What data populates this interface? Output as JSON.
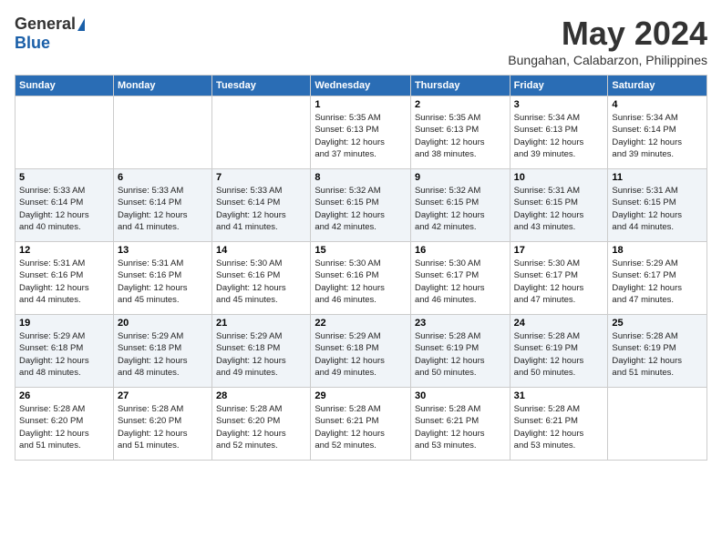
{
  "header": {
    "logo_general": "General",
    "logo_blue": "Blue",
    "month_year": "May 2024",
    "location": "Bungahan, Calabarzon, Philippines"
  },
  "days_of_week": [
    "Sunday",
    "Monday",
    "Tuesday",
    "Wednesday",
    "Thursday",
    "Friday",
    "Saturday"
  ],
  "weeks": [
    [
      {
        "day": "",
        "info": ""
      },
      {
        "day": "",
        "info": ""
      },
      {
        "day": "",
        "info": ""
      },
      {
        "day": "1",
        "info": "Sunrise: 5:35 AM\nSunset: 6:13 PM\nDaylight: 12 hours\nand 37 minutes."
      },
      {
        "day": "2",
        "info": "Sunrise: 5:35 AM\nSunset: 6:13 PM\nDaylight: 12 hours\nand 38 minutes."
      },
      {
        "day": "3",
        "info": "Sunrise: 5:34 AM\nSunset: 6:13 PM\nDaylight: 12 hours\nand 39 minutes."
      },
      {
        "day": "4",
        "info": "Sunrise: 5:34 AM\nSunset: 6:14 PM\nDaylight: 12 hours\nand 39 minutes."
      }
    ],
    [
      {
        "day": "5",
        "info": "Sunrise: 5:33 AM\nSunset: 6:14 PM\nDaylight: 12 hours\nand 40 minutes."
      },
      {
        "day": "6",
        "info": "Sunrise: 5:33 AM\nSunset: 6:14 PM\nDaylight: 12 hours\nand 41 minutes."
      },
      {
        "day": "7",
        "info": "Sunrise: 5:33 AM\nSunset: 6:14 PM\nDaylight: 12 hours\nand 41 minutes."
      },
      {
        "day": "8",
        "info": "Sunrise: 5:32 AM\nSunset: 6:15 PM\nDaylight: 12 hours\nand 42 minutes."
      },
      {
        "day": "9",
        "info": "Sunrise: 5:32 AM\nSunset: 6:15 PM\nDaylight: 12 hours\nand 42 minutes."
      },
      {
        "day": "10",
        "info": "Sunrise: 5:31 AM\nSunset: 6:15 PM\nDaylight: 12 hours\nand 43 minutes."
      },
      {
        "day": "11",
        "info": "Sunrise: 5:31 AM\nSunset: 6:15 PM\nDaylight: 12 hours\nand 44 minutes."
      }
    ],
    [
      {
        "day": "12",
        "info": "Sunrise: 5:31 AM\nSunset: 6:16 PM\nDaylight: 12 hours\nand 44 minutes."
      },
      {
        "day": "13",
        "info": "Sunrise: 5:31 AM\nSunset: 6:16 PM\nDaylight: 12 hours\nand 45 minutes."
      },
      {
        "day": "14",
        "info": "Sunrise: 5:30 AM\nSunset: 6:16 PM\nDaylight: 12 hours\nand 45 minutes."
      },
      {
        "day": "15",
        "info": "Sunrise: 5:30 AM\nSunset: 6:16 PM\nDaylight: 12 hours\nand 46 minutes."
      },
      {
        "day": "16",
        "info": "Sunrise: 5:30 AM\nSunset: 6:17 PM\nDaylight: 12 hours\nand 46 minutes."
      },
      {
        "day": "17",
        "info": "Sunrise: 5:30 AM\nSunset: 6:17 PM\nDaylight: 12 hours\nand 47 minutes."
      },
      {
        "day": "18",
        "info": "Sunrise: 5:29 AM\nSunset: 6:17 PM\nDaylight: 12 hours\nand 47 minutes."
      }
    ],
    [
      {
        "day": "19",
        "info": "Sunrise: 5:29 AM\nSunset: 6:18 PM\nDaylight: 12 hours\nand 48 minutes."
      },
      {
        "day": "20",
        "info": "Sunrise: 5:29 AM\nSunset: 6:18 PM\nDaylight: 12 hours\nand 48 minutes."
      },
      {
        "day": "21",
        "info": "Sunrise: 5:29 AM\nSunset: 6:18 PM\nDaylight: 12 hours\nand 49 minutes."
      },
      {
        "day": "22",
        "info": "Sunrise: 5:29 AM\nSunset: 6:18 PM\nDaylight: 12 hours\nand 49 minutes."
      },
      {
        "day": "23",
        "info": "Sunrise: 5:28 AM\nSunset: 6:19 PM\nDaylight: 12 hours\nand 50 minutes."
      },
      {
        "day": "24",
        "info": "Sunrise: 5:28 AM\nSunset: 6:19 PM\nDaylight: 12 hours\nand 50 minutes."
      },
      {
        "day": "25",
        "info": "Sunrise: 5:28 AM\nSunset: 6:19 PM\nDaylight: 12 hours\nand 51 minutes."
      }
    ],
    [
      {
        "day": "26",
        "info": "Sunrise: 5:28 AM\nSunset: 6:20 PM\nDaylight: 12 hours\nand 51 minutes."
      },
      {
        "day": "27",
        "info": "Sunrise: 5:28 AM\nSunset: 6:20 PM\nDaylight: 12 hours\nand 51 minutes."
      },
      {
        "day": "28",
        "info": "Sunrise: 5:28 AM\nSunset: 6:20 PM\nDaylight: 12 hours\nand 52 minutes."
      },
      {
        "day": "29",
        "info": "Sunrise: 5:28 AM\nSunset: 6:21 PM\nDaylight: 12 hours\nand 52 minutes."
      },
      {
        "day": "30",
        "info": "Sunrise: 5:28 AM\nSunset: 6:21 PM\nDaylight: 12 hours\nand 53 minutes."
      },
      {
        "day": "31",
        "info": "Sunrise: 5:28 AM\nSunset: 6:21 PM\nDaylight: 12 hours\nand 53 minutes."
      },
      {
        "day": "",
        "info": ""
      }
    ]
  ]
}
